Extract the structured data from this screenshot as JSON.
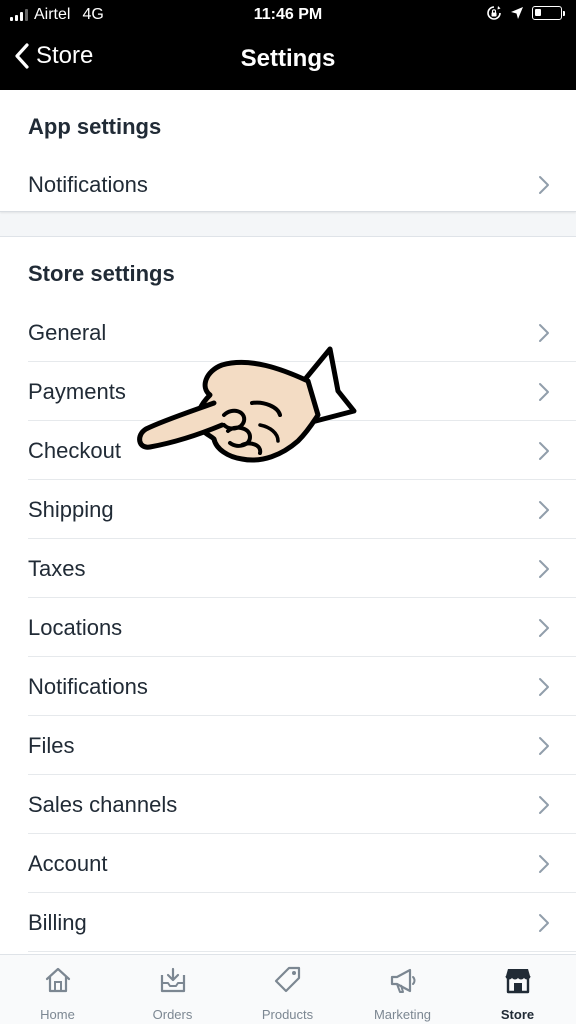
{
  "status_bar": {
    "carrier": "Airtel",
    "network": "4G",
    "time": "11:46 PM"
  },
  "nav": {
    "back_label": "Store",
    "title": "Settings"
  },
  "app_settings": {
    "heading": "App settings",
    "items": [
      {
        "label": "Notifications"
      }
    ]
  },
  "store_settings": {
    "heading": "Store settings",
    "items": [
      {
        "label": "General"
      },
      {
        "label": "Payments"
      },
      {
        "label": "Checkout"
      },
      {
        "label": "Shipping"
      },
      {
        "label": "Taxes"
      },
      {
        "label": "Locations"
      },
      {
        "label": "Notifications"
      },
      {
        "label": "Files"
      },
      {
        "label": "Sales channels"
      },
      {
        "label": "Account"
      },
      {
        "label": "Billing"
      }
    ]
  },
  "tabs": [
    {
      "label": "Home",
      "icon": "home-icon"
    },
    {
      "label": "Orders",
      "icon": "inbox-icon"
    },
    {
      "label": "Products",
      "icon": "tag-icon"
    },
    {
      "label": "Marketing",
      "icon": "megaphone-icon"
    },
    {
      "label": "Store",
      "icon": "store-icon",
      "active": true
    }
  ],
  "colors": {
    "text": "#212b36",
    "chevron": "#919eab",
    "tab_inactive": "#7c8792",
    "hand_fill": "#f3dcc4"
  }
}
